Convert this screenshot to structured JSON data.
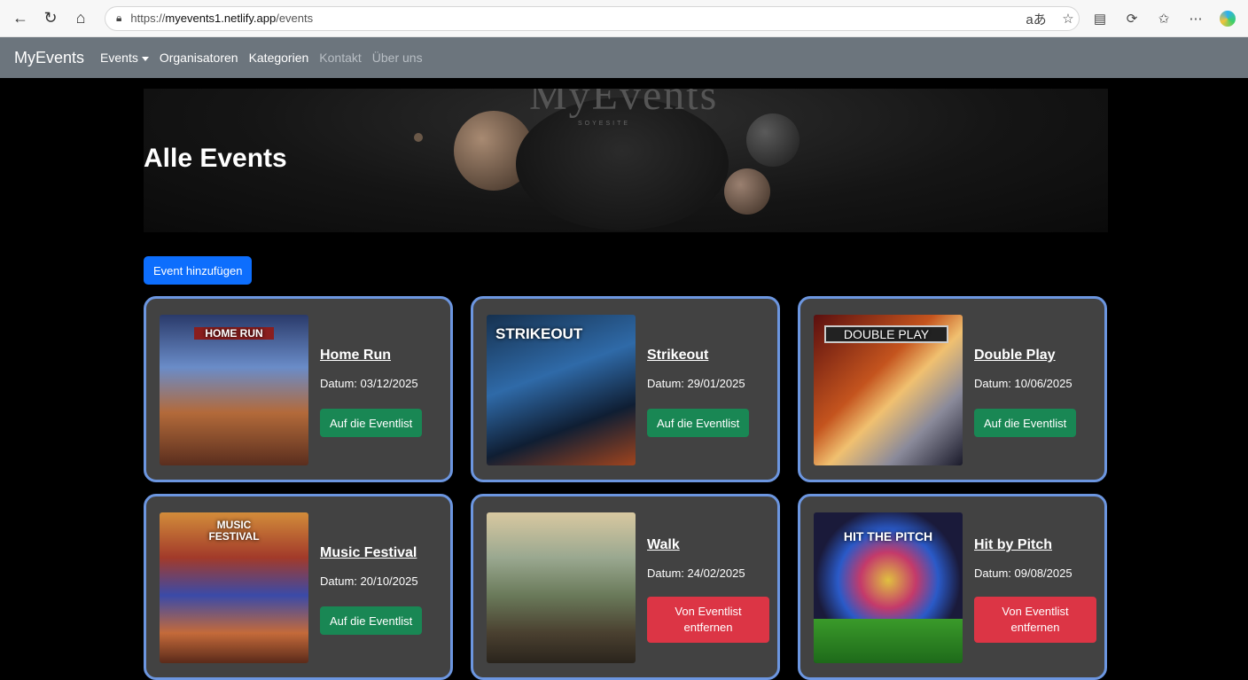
{
  "browser": {
    "url_prefix": "https://",
    "url_domain": "myevents1.netlify.app",
    "url_path": "/events",
    "reader_label": "aあ"
  },
  "navbar": {
    "brand": "MyEvents",
    "items": [
      {
        "label": "Events",
        "active": true
      },
      {
        "label": "Organisatoren",
        "active": true
      },
      {
        "label": "Kategorien",
        "active": true
      },
      {
        "label": "Kontakt",
        "active": false
      },
      {
        "label": "Über uns",
        "active": false
      }
    ]
  },
  "hero": {
    "title": "Alle Events",
    "logo_text": "MyEvents",
    "logo_sub": "SOYESITE"
  },
  "add_button": "Event hinzufügen",
  "cards": [
    {
      "title": "Home Run",
      "date": "Datum: 03/12/2025",
      "action": "Auf die Eventlist",
      "action_type": "add",
      "image_label": "HOME RUN"
    },
    {
      "title": "Strikeout",
      "date": "Datum: 29/01/2025",
      "action": "Auf die Eventlist",
      "action_type": "add",
      "image_label": "STRIKEOUT"
    },
    {
      "title": "Double Play",
      "date": "Datum: 10/06/2025",
      "action": "Auf die Eventlist",
      "action_type": "add",
      "image_label": "DOUBLE PLAY"
    },
    {
      "title": "Music Festival",
      "date": "Datum: 20/10/2025",
      "action": "Auf die Eventlist",
      "action_type": "add",
      "image_label": "MUSIC FESTIVAL"
    },
    {
      "title": "Walk",
      "date": "Datum: 24/02/2025",
      "action": "Von Eventlist entfernen",
      "action_type": "remove",
      "image_label": ""
    },
    {
      "title": "Hit by Pitch",
      "date": "Datum: 09/08/2025",
      "action": "Von Eventlist entfernen",
      "action_type": "remove",
      "image_label": "HIT THE PITCH"
    }
  ],
  "colors": {
    "navbar": "#6c757d",
    "card_bg": "#424242",
    "card_border": "#6c96e0",
    "primary": "#0d6efd",
    "success": "#198754",
    "danger": "#dc3545"
  }
}
